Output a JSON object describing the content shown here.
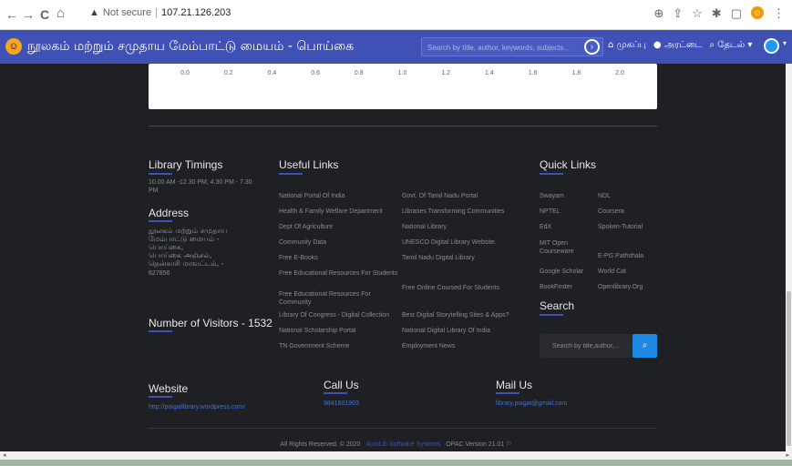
{
  "browser": {
    "back": "←",
    "forward": "→",
    "reload": "C",
    "home": "⌂",
    "warning_glyph": "▲",
    "security_label": "Not secure",
    "separator": "|",
    "url": "107.21.126.203",
    "icons": [
      "zoom-icon",
      "share-icon",
      "star-icon",
      "extensions-icon",
      "sidebar-icon",
      "profile-icon",
      "menu-icon"
    ]
  },
  "header": {
    "title": "நூலகம் மற்றும் சமுதாய மேம்பாட்டு மையம் - பொய்கை",
    "search_placeholder": "Search by title, author, keywords, subjects...",
    "menu": {
      "home": "முகப்பு",
      "chat": "அரட்டை",
      "search": "தேடல்"
    }
  },
  "chart_data": {
    "type": "bar",
    "x_ticks": [
      "0.0",
      "0.2",
      "0.4",
      "0.6",
      "0.8",
      "1.0",
      "1.2",
      "1.4",
      "1.6",
      "1.8",
      "2.0"
    ],
    "xlim": [
      0.0,
      2.0
    ]
  },
  "footer": {
    "timings": {
      "heading": "Library Timings",
      "text": "10.00 AM -12.30 PM; 4.30 PM - 7.30 PM"
    },
    "address": {
      "heading": "Address",
      "lines": [
        "நூலகம் மற்றும் சமுதாய",
        "மேம்பாட்டு மையம் -",
        "பொய்கை,",
        "பொய்கை அஞ்சல்,",
        "தென்காசி மாவட்டம், -",
        "627856"
      ]
    },
    "visitors": "Number of Visitors - 1532",
    "useful_links": {
      "heading": "Useful Links",
      "col1": [
        "National Portal Of India",
        "Health & Family Welfare Department",
        "Dept Of Agriculture",
        "Community Data",
        "Free E-Books",
        "Free Educational Resources For Students",
        "Free Educational Resources For Community",
        "Library Of Congress - Digital Collection",
        "National Scholarship Portal",
        "TN Government Scheme"
      ],
      "col2": [
        "Govt. Of Tamil Nadu Portal",
        "Libraries Transforming Communities",
        "National Library",
        "UNESCO Digital Library Website.",
        "Tamil Nadu Digital Library",
        "Free Online Coursed For Students",
        "Best Digital Storytelling Sites & Apps?",
        "National Digital Library Of India",
        "Employment News"
      ]
    },
    "quick_links": {
      "heading": "Quick Links",
      "col1": [
        "Swayam",
        "NPTEL",
        "EdX",
        "MIT Open Courseware",
        "Google Scholar",
        "BookFinder"
      ],
      "col2": [
        "NDL",
        "Coursera",
        "Spoken-Tutorial",
        "E-PG Pathshala",
        "World Cat",
        "Openlibrary.Org"
      ]
    },
    "search": {
      "heading": "Search",
      "placeholder": "Search by title,author,..."
    },
    "website": {
      "heading": "Website",
      "url": "http://poigailibrary.wordpress.com/"
    },
    "call": {
      "heading": "Call Us",
      "phone": "9841601903"
    },
    "mail": {
      "heading": "Mail Us",
      "email": "library.poigai@gmail.com"
    },
    "copyright": {
      "prefix": "All Rights Reserved. © 2020",
      "brand": "AutoLib Software Systems",
      "version": "OPAC Version 21.01"
    }
  }
}
